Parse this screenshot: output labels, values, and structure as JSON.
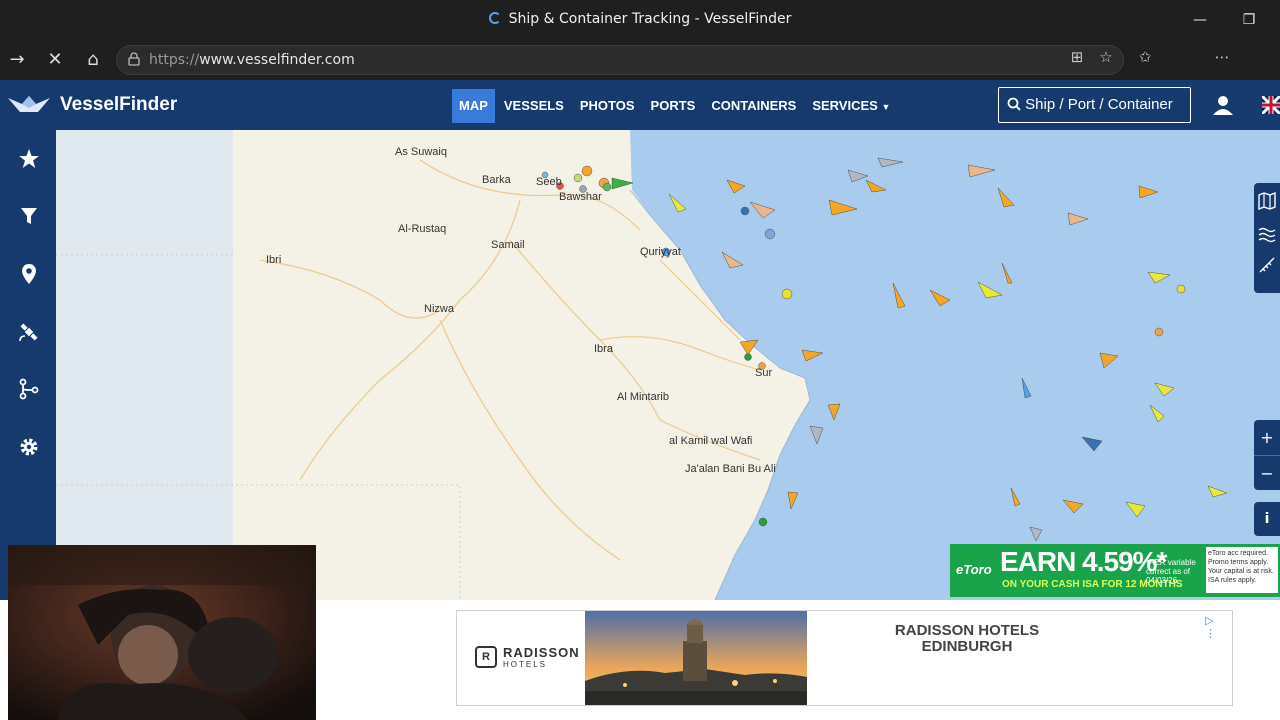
{
  "browser": {
    "window_title": "Ship & Container Tracking - VesselFinder",
    "url_scheme": "https://",
    "url_host": "www.vesselfinder.com"
  },
  "site": {
    "logo": "VesselFinder",
    "menu": [
      {
        "label": "MAP",
        "active": true
      },
      {
        "label": "VESSELS",
        "active": false
      },
      {
        "label": "PHOTOS",
        "active": false
      },
      {
        "label": "PORTS",
        "active": false
      },
      {
        "label": "CONTAINERS",
        "active": false
      },
      {
        "label": "SERVICES",
        "active": false
      }
    ],
    "search_label": "Ship / Port / Container",
    "accent": "#3a7ad8",
    "header_bg": "#163a6e"
  },
  "sidebar": {
    "icons": [
      "star-icon",
      "filter-icon",
      "location-pin-icon",
      "satellite-icon",
      "route-icon",
      "gear-icon"
    ]
  },
  "map": {
    "places": [
      "As Suwaiq",
      "Barka",
      "Seeb",
      "Bawshar",
      "Al-Rustaq",
      "Samail",
      "Quriyyat",
      "Ibri",
      "Nizwa",
      "Ibra",
      "Sur",
      "Al Mintarib",
      "al Kamil wal Wafi",
      "Ja'alan Bani Bu Ali"
    ],
    "zoom_in": "+",
    "zoom_out": "−",
    "info": "i"
  },
  "ads": {
    "radisson_brand": "RADISSON",
    "radisson_brand_sub": "HOTELS",
    "radisson_headline_1": "RADISSON HOTELS",
    "radisson_headline_2": "EDINBURGH",
    "etoro_brand": "eToro",
    "etoro_headline": "EARN 4.59%*",
    "etoro_sub": "ON YOUR CASH ISA FOR 12 MONTHS",
    "etoro_fine": "*AER variable correct as of 04/03/26",
    "etoro_right": "eToro acc required. Promo terms apply. Your capital is at risk. ISA rules apply."
  }
}
